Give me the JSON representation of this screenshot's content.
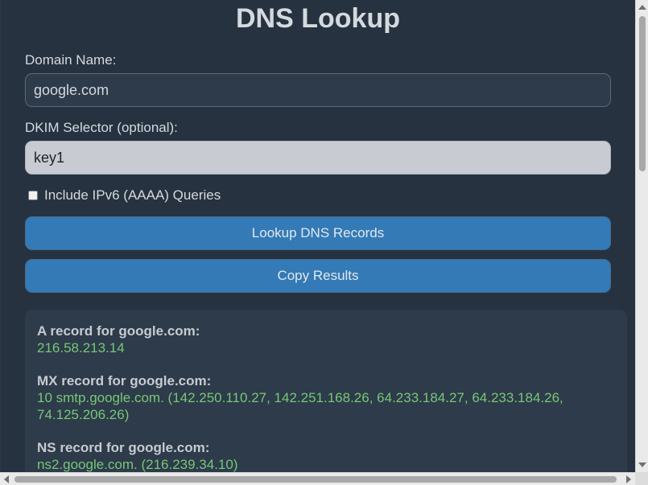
{
  "title": "DNS Lookup",
  "form": {
    "domain_label": "Domain Name:",
    "domain_value": "google.com",
    "dkim_label": "DKIM Selector (optional):",
    "dkim_value": "key1",
    "ipv6_label": "Include IPv6 (AAAA) Queries",
    "ipv6_checked": false
  },
  "buttons": {
    "lookup_label": "Lookup DNS Records",
    "copy_label": "Copy Results"
  },
  "results": [
    {
      "title": "A record for google.com:",
      "value": "216.58.213.14"
    },
    {
      "title": "MX record for google.com:",
      "value": "10 smtp.google.com. (142.250.110.27, 142.251.168.26, 64.233.184.27, 64.233.184.26, 74.125.206.26)"
    },
    {
      "title": "NS record for google.com:",
      "value": "ns2.google.com. (216.239.34.10)"
    }
  ],
  "colors": {
    "background": "#263240",
    "panel": "#2d3b4a",
    "button": "#337ab7",
    "record_value": "#77c777"
  }
}
